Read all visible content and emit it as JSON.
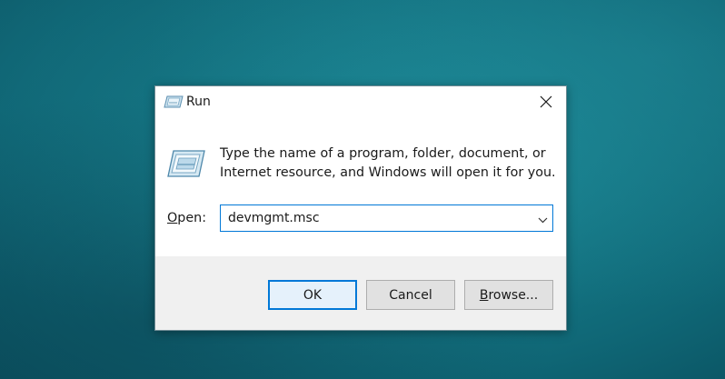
{
  "dialog": {
    "title": "Run",
    "description": "Type the name of a program, folder, document, or Internet resource, and Windows will open it for you.",
    "open_label_accel": "O",
    "open_label_rest": "pen:",
    "command_value": "devmgmt.msc",
    "buttons": {
      "ok_label": "OK",
      "cancel_label": "Cancel",
      "browse_accel": "B",
      "browse_rest": "rowse..."
    }
  },
  "icons": {
    "title": "run-icon",
    "large": "run-icon",
    "close": "close-icon",
    "dropdown": "chevron-down-icon"
  },
  "colors": {
    "accent": "#0078d7",
    "desktop": "#167a88",
    "button_bar": "#f0f0f0"
  }
}
